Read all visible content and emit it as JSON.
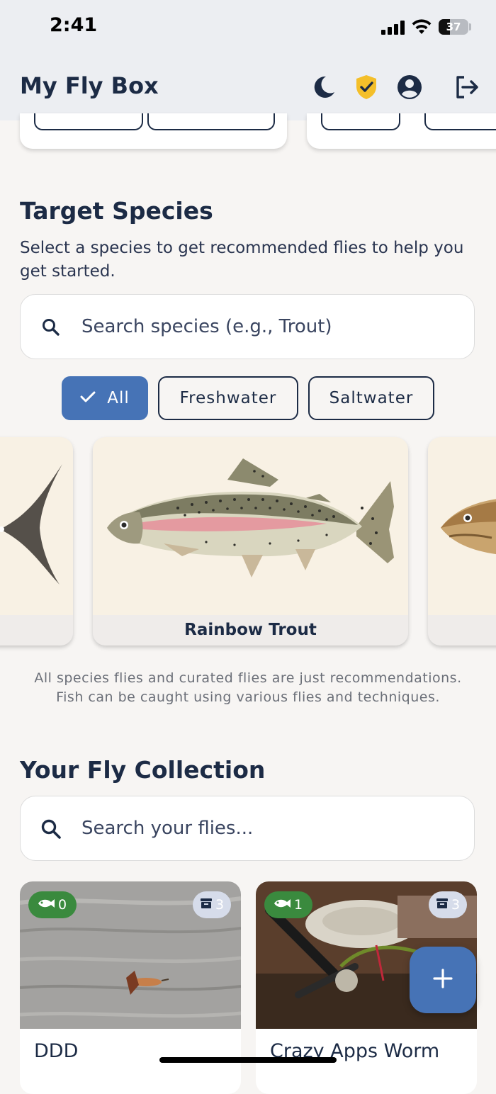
{
  "status_bar": {
    "time": "2:41",
    "battery": "37",
    "battery_level": 0.37
  },
  "header": {
    "title": "My Fly Box",
    "icons": [
      "moon-icon",
      "shield-check-icon",
      "account-icon",
      "logout-icon"
    ]
  },
  "target_species": {
    "title": "Target Species",
    "description": "Select a species to get recommended flies to help you get started.",
    "search_placeholder": "Search species (e.g., Trout)",
    "filters": [
      {
        "label": "All",
        "selected": true
      },
      {
        "label": "Freshwater",
        "selected": false
      },
      {
        "label": "Saltwater",
        "selected": false
      }
    ],
    "cards": [
      {
        "name": ""
      },
      {
        "name": "Rainbow Trout"
      },
      {
        "name": ""
      }
    ],
    "disclaimer": "All species flies and curated flies are just recommendations. Fish can be caught using various flies and techniques."
  },
  "fly_collection": {
    "title": "Your Fly Collection",
    "search_placeholder": "Search your flies...",
    "flies": [
      {
        "title": "DDD",
        "caught": "0",
        "boxes": "3"
      },
      {
        "title": "Crazy Apps Worm",
        "caught": "1",
        "boxes": "3"
      }
    ]
  },
  "fab": {
    "icon": "plus-icon",
    "label": "+"
  },
  "colors": {
    "primary": "#4673b6",
    "navy": "#1c2b45",
    "shield": "#f4bf2a",
    "caught_badge": "#3a8a3e",
    "background": "#f7f5f3"
  }
}
